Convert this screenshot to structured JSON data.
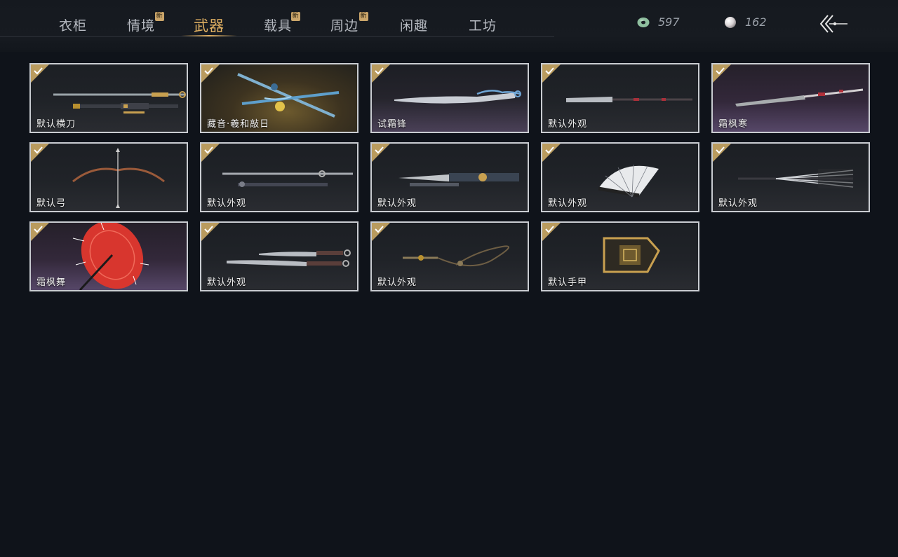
{
  "tabs": [
    {
      "label": "衣柜",
      "new": ""
    },
    {
      "label": "情境",
      "new": "新"
    },
    {
      "label": "武器",
      "new": ""
    },
    {
      "label": "载具",
      "new": "新"
    },
    {
      "label": "周边",
      "new": "新"
    },
    {
      "label": "闲趣",
      "new": ""
    },
    {
      "label": "工坊",
      "new": ""
    }
  ],
  "active_tab": "武器",
  "currencies": [
    {
      "icon": "jade-coin-icon",
      "value": "597"
    },
    {
      "icon": "pearl-icon",
      "value": "162"
    }
  ],
  "back_icon": "back-arrow-icon",
  "items": [
    {
      "label": "默认横刀",
      "owned": true,
      "icon": "sword-icon"
    },
    {
      "label": "藏音·羲和敲日",
      "owned": true,
      "icon": "twin-blade-icon"
    },
    {
      "label": "试霜锋",
      "owned": true,
      "icon": "frost-blade-icon"
    },
    {
      "label": "默认外观",
      "owned": true,
      "icon": "long-blade-icon"
    },
    {
      "label": "霜枫寒",
      "owned": true,
      "icon": "long-blade-icon"
    },
    {
      "label": "默认弓",
      "owned": true,
      "icon": "bow-icon"
    },
    {
      "label": "默认外观",
      "owned": true,
      "icon": "spear-icon"
    },
    {
      "label": "默认外观",
      "owned": true,
      "icon": "dagger-icon"
    },
    {
      "label": "默认外观",
      "owned": true,
      "icon": "fan-icon"
    },
    {
      "label": "默认外观",
      "owned": true,
      "icon": "closed-fan-icon"
    },
    {
      "label": "霜枫舞",
      "owned": true,
      "icon": "umbrella-icon"
    },
    {
      "label": "默认外观",
      "owned": true,
      "icon": "dual-swords-icon"
    },
    {
      "label": "默认外观",
      "owned": true,
      "icon": "rope-dart-icon"
    },
    {
      "label": "默认手甲",
      "owned": true,
      "icon": "gauntlet-icon"
    }
  ]
}
